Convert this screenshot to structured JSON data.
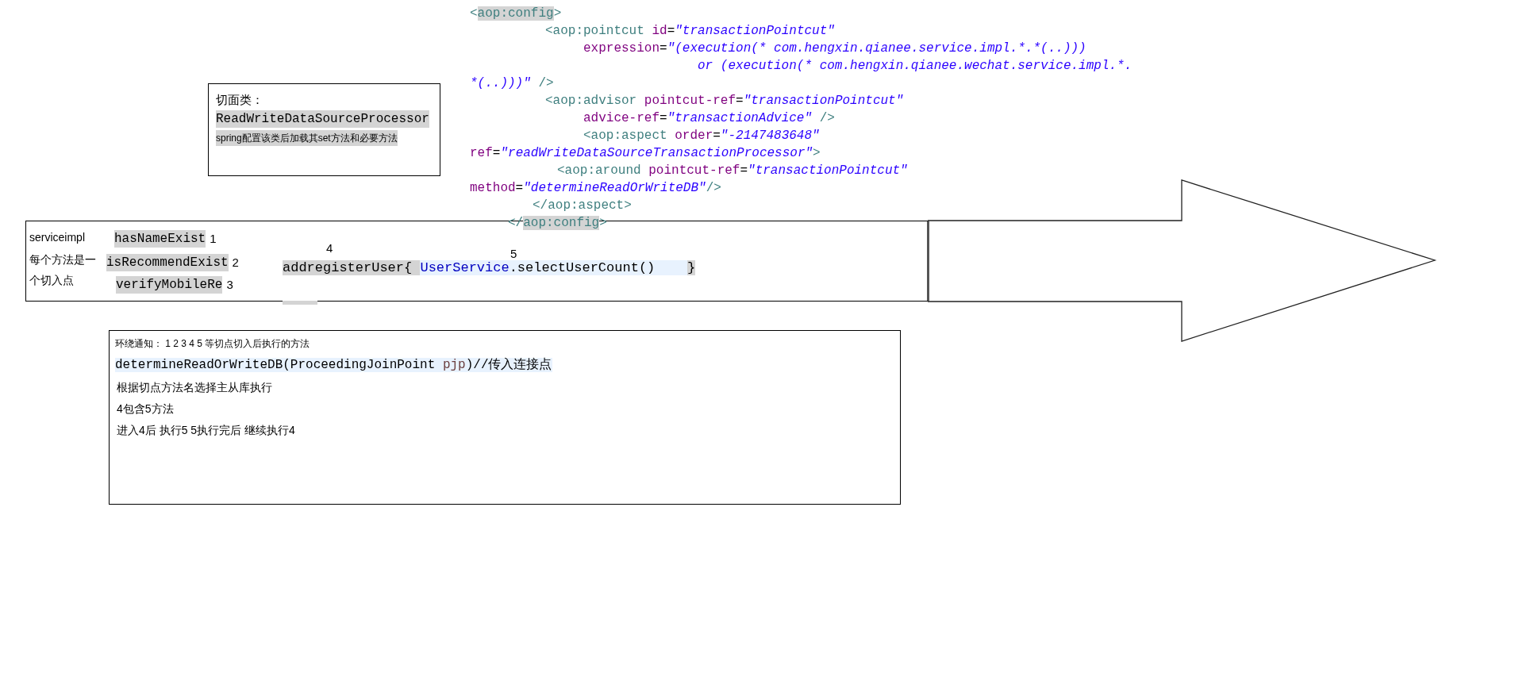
{
  "code_snippet": {
    "lines": [
      {
        "segments": [
          {
            "text": "<",
            "kind": "tag"
          },
          {
            "text": "aop:config",
            "kind": "tag_hl"
          },
          {
            "text": ">",
            "kind": "tag"
          }
        ]
      },
      {
        "segments": [
          {
            "text": "<aop:pointcut",
            "kind": "tag"
          },
          {
            "text": " id",
            "kind": "attr"
          },
          {
            "text": "=",
            "kind": "plain"
          },
          {
            "text": "\"transactionPointcut\"",
            "kind": "value"
          }
        ]
      },
      {
        "segments": [
          {
            "text": "expression",
            "kind": "attr"
          },
          {
            "text": "=",
            "kind": "plain"
          },
          {
            "text": "\"(execution(* com.hengxin.qianee.service.impl.*.*(..)))",
            "kind": "value"
          }
        ]
      },
      {
        "segments": [
          {
            "text": "or (execution(* com.hengxin.qianee.wechat.service.impl.*.",
            "kind": "value"
          }
        ]
      },
      {
        "segments": [
          {
            "text": "*(..)))\"",
            "kind": "value"
          },
          {
            "text": " />",
            "kind": "tag"
          }
        ]
      },
      {
        "segments": [
          {
            "text": "<aop:advisor",
            "kind": "tag"
          },
          {
            "text": " pointcut-ref",
            "kind": "attr"
          },
          {
            "text": "=",
            "kind": "plain"
          },
          {
            "text": "\"transactionPointcut\"",
            "kind": "value"
          }
        ]
      },
      {
        "segments": [
          {
            "text": "advice-ref",
            "kind": "attr"
          },
          {
            "text": "=",
            "kind": "plain"
          },
          {
            "text": "\"transactionAdvice\"",
            "kind": "value"
          },
          {
            "text": " />",
            "kind": "tag"
          }
        ]
      },
      {
        "segments": [
          {
            "text": "<aop:aspect",
            "kind": "tag"
          },
          {
            "text": " order",
            "kind": "attr"
          },
          {
            "text": "=",
            "kind": "plain"
          },
          {
            "text": "\"-2147483648\"",
            "kind": "value"
          }
        ]
      },
      {
        "segments": [
          {
            "text": "ref",
            "kind": "attr"
          },
          {
            "text": "=",
            "kind": "plain"
          },
          {
            "text": "\"readWriteDataSourceTransactionProcessor\"",
            "kind": "value"
          },
          {
            "text": ">",
            "kind": "tag"
          }
        ]
      },
      {
        "segments": [
          {
            "text": "<aop:around",
            "kind": "tag"
          },
          {
            "text": " pointcut-ref",
            "kind": "attr"
          },
          {
            "text": "=",
            "kind": "plain"
          },
          {
            "text": "\"transactionPointcut\"",
            "kind": "value"
          }
        ]
      },
      {
        "segments": [
          {
            "text": "method",
            "kind": "attr"
          },
          {
            "text": "=",
            "kind": "plain"
          },
          {
            "text": "\"determineReadOrWriteDB\"",
            "kind": "value"
          },
          {
            "text": "/>",
            "kind": "tag"
          }
        ]
      },
      {
        "segments": [
          {
            "text": "</aop:aspect>",
            "kind": "tag"
          }
        ]
      },
      {
        "segments": [
          {
            "text": "</",
            "kind": "tag"
          },
          {
            "text": "aop:config",
            "kind": "tag_hl"
          },
          {
            "text": ">",
            "kind": "tag"
          }
        ]
      }
    ]
  },
  "aspect_note": {
    "title": "切面类：",
    "class_name": "ReadWriteDataSourceProcessor",
    "description": "spring配置该类后加载其set方法和必要方法"
  },
  "service_box": {
    "labels": [
      "serviceimpl",
      "每个方法是一",
      "个切入点"
    ],
    "methods": [
      {
        "name": "hasNameExist",
        "number": "1"
      },
      {
        "name": "isRecommendExist",
        "number": "2"
      },
      {
        "name": "verifyMobileRe",
        "number": "3"
      }
    ],
    "step_labels": [
      "4",
      "5"
    ],
    "call_line": {
      "segments": [
        {
          "text": "addregisterUser{ ",
          "kind": "gray"
        },
        {
          "text": "UserService",
          "kind": "type"
        },
        {
          "text": ".selectUserCount()    ",
          "kind": "blue"
        },
        {
          "text": "}",
          "kind": "gray"
        }
      ]
    }
  },
  "around_note": {
    "title": "环绕通知： 1 2 3 4 5 等切点切入后执行的方法",
    "signature": {
      "segments": [
        {
          "text": "determineReadOrWriteDB(ProceedingJoinPoint ",
          "kind": "blue"
        },
        {
          "text": "pjp",
          "kind": "param"
        },
        {
          "text": ")//传入连接点",
          "kind": "blue"
        }
      ]
    },
    "lines": [
      "根据切点方法名选择主从库执行",
      "4包含5方法",
      "进入4后 执行5 5执行完后 继续执行4"
    ]
  }
}
